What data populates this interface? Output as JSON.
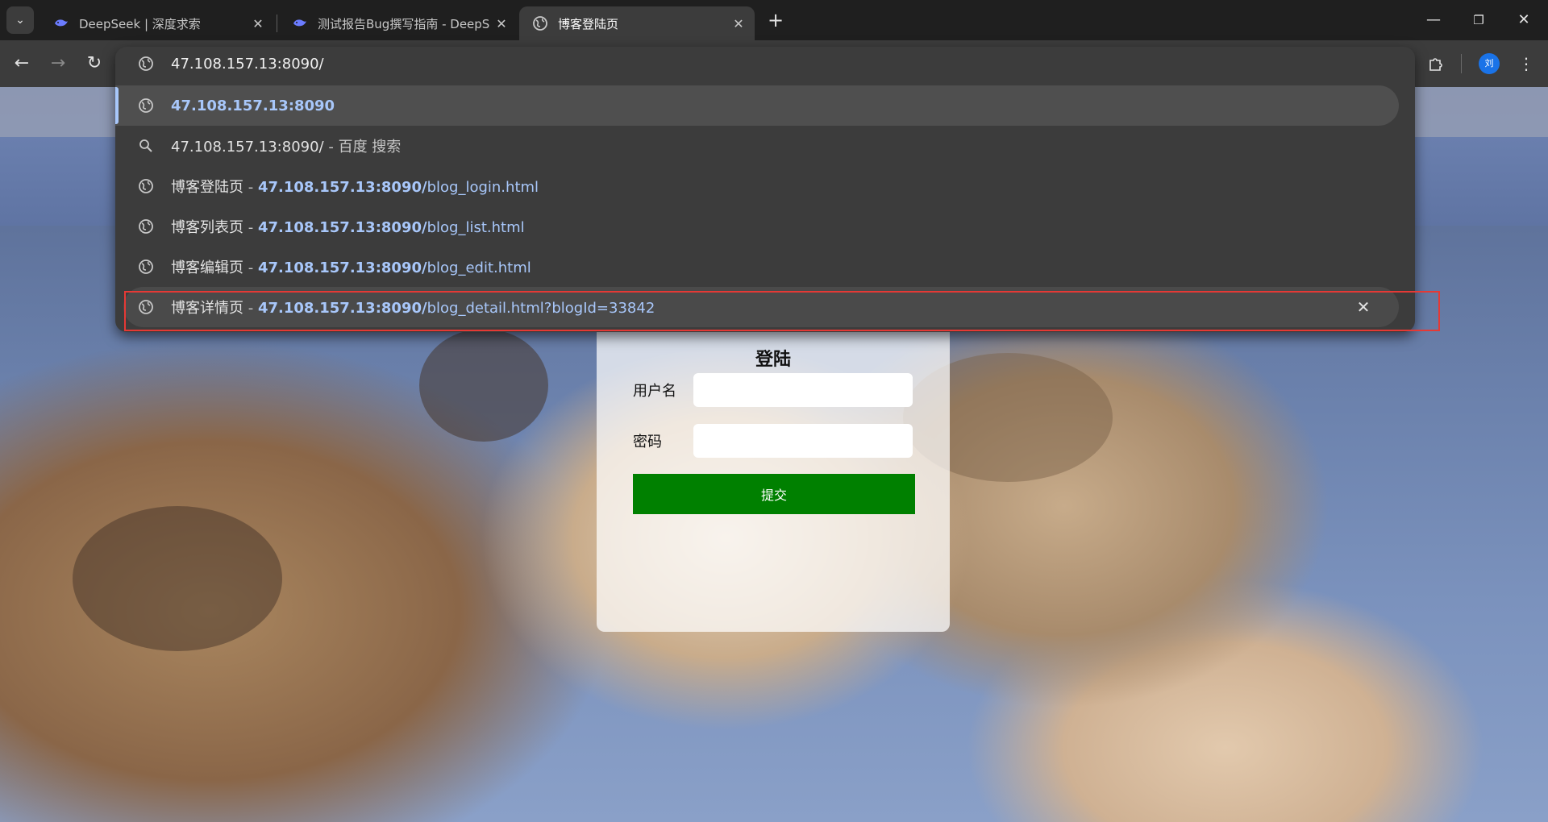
{
  "browser": {
    "tabs": [
      {
        "title": "DeepSeek | 深度求索",
        "icon": "deepseek-whale-icon",
        "active": false
      },
      {
        "title": "测试报告Bug撰写指南 - DeepS",
        "icon": "deepseek-whale-icon",
        "active": false
      },
      {
        "title": "博客登陆页",
        "icon": "globe-icon",
        "active": true
      }
    ],
    "profile_initial": "刘"
  },
  "omnibox": {
    "input_value": "47.108.157.13:8090/",
    "suggestions": [
      {
        "icon": "globe-icon",
        "title": "",
        "sep": "",
        "host": "47.108.157.13:8090",
        "path": "",
        "selected": true
      },
      {
        "icon": "search-icon",
        "title": "47.108.157.13:8090/",
        "sep": " - ",
        "host": "",
        "path": "",
        "suffix": "百度 搜索"
      },
      {
        "icon": "globe-icon",
        "title": "博客登陆页",
        "sep": " - ",
        "host": "47.108.157.13:8090/",
        "path": "blog_login.html"
      },
      {
        "icon": "globe-icon",
        "title": "博客列表页",
        "sep": " - ",
        "host": "47.108.157.13:8090/",
        "path": "blog_list.html"
      },
      {
        "icon": "globe-icon",
        "title": "博客编辑页",
        "sep": " - ",
        "host": "47.108.157.13:8090/",
        "path": "blog_edit.html"
      },
      {
        "icon": "globe-icon",
        "title": "博客详情页",
        "sep": " - ",
        "host": "47.108.157.13:8090/",
        "path": "blog_detail.html?blogId=33842",
        "hovered": true,
        "removable": true
      }
    ]
  },
  "login": {
    "title": "登陆",
    "username_label": "用户名",
    "password_label": "密码",
    "submit_label": "提交"
  }
}
